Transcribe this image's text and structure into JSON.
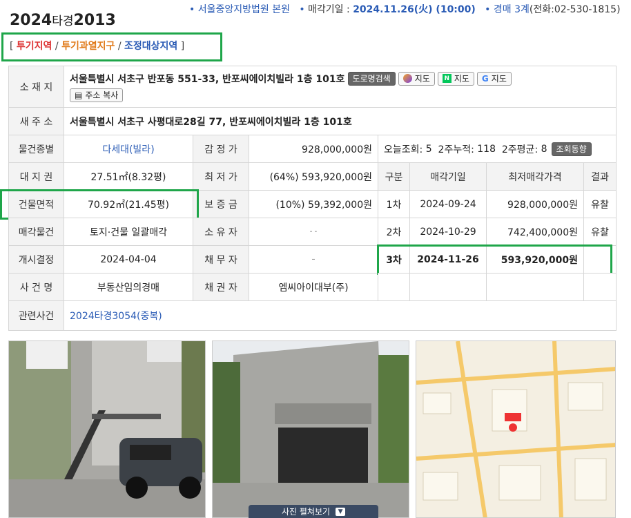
{
  "header": {
    "case_year": "2024",
    "case_type": "타경",
    "case_no": "2013",
    "court_bullet": "•",
    "court": "서울중앙지방법원 본원",
    "date_label": "매각기일 :",
    "date_value": "2024.11.26(火) (10:00)",
    "dept_label": "경매 3계",
    "phone": "(전화:02-530-1815)"
  },
  "zones": {
    "open": "[",
    "z1": "투기지역",
    "z2": "투기과열지구",
    "z3": "조정대상지역",
    "sep": "/",
    "close": "]"
  },
  "info": {
    "location_label": "소 재 지",
    "location": "서울특별시 서초구 반포동 551-33, 반포씨에이치빌라 1층 101호",
    "btn_road": "도로명검색",
    "btn_daum": "지도",
    "btn_naver": "지도",
    "btn_google": "지도",
    "btn_copy": "주소 복사",
    "newaddr_label": "새 주 소",
    "newaddr": "서울특별시 서초구 사평대로28길 77, 반포씨에이치빌라 1층 101호",
    "kind_label": "물건종별",
    "kind": "다세대(빌라)",
    "appraisal_label": "감 정 가",
    "appraisal": "928,000,000원",
    "land_label": "대 지 권",
    "land": "27.51㎡(8.32평)",
    "min_label": "최 저 가",
    "min": "(64%) 593,920,000원",
    "area_label": "건물면적",
    "area": "70.92㎡(21.45평)",
    "deposit_label": "보 증 금",
    "deposit": "(10%) 59,392,000원",
    "sale_label": "매각물건",
    "sale": "토지·건물 일괄매각",
    "owner_label": "소 유 자",
    "owner": "-   -",
    "start_label": "개시결정",
    "start": "2024-04-04",
    "debtor_label": "채 무 자",
    "debtor": "–",
    "casename_label": "사 건 명",
    "casename": "부동산임의경매",
    "creditor_label": "채 권 자",
    "creditor": "엠씨아이대부(주)",
    "related_label": "관련사건",
    "related": "2024타경3054(중복)"
  },
  "views": {
    "today_label": "오늘조회:",
    "today": "5",
    "two_week_label": "2주누적:",
    "two_week": "118",
    "avg_label": "2주평균:",
    "avg": "8",
    "trend_btn": "조회동향"
  },
  "rounds": {
    "headers": [
      "구분",
      "매각기일",
      "최저매각가격",
      "결과"
    ],
    "rows": [
      {
        "round": "1차",
        "date": "2024-09-24",
        "price": "928,000,000원",
        "result": "유찰"
      },
      {
        "round": "2차",
        "date": "2024-10-29",
        "price": "742,400,000원",
        "result": "유찰"
      },
      {
        "round": "3차",
        "date": "2024-11-26",
        "price": "593,920,000원",
        "result": ""
      }
    ]
  },
  "photos": {
    "expand_label": "사진 펼쳐보기"
  },
  "colors": {
    "accent_blue": "#2a5bb5",
    "highlight_green": "#1fa64a",
    "red": "#d33333",
    "orange": "#e07a1a"
  }
}
